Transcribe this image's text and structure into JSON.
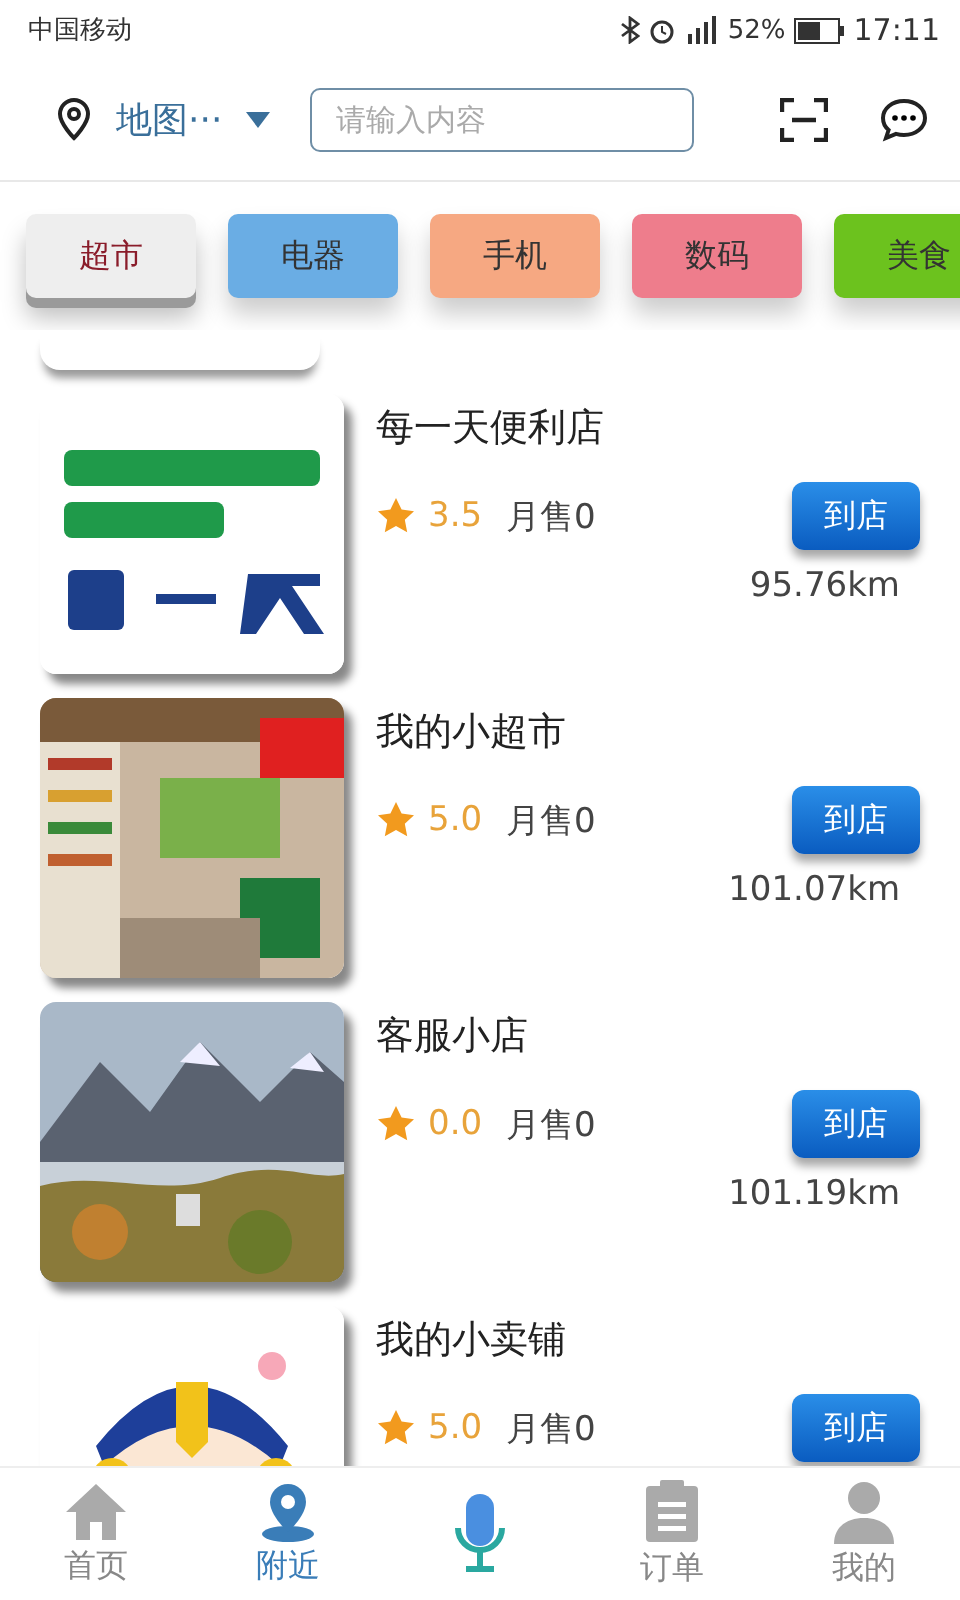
{
  "status_bar": {
    "carrier": "中国移动",
    "battery": "52%",
    "time": "17:11"
  },
  "header": {
    "location": "地图···",
    "search": {
      "placeholder": "请输入内容"
    }
  },
  "categories": [
    {
      "label": "超市",
      "color": "#eeeeee",
      "selected": true
    },
    {
      "label": "电器",
      "color": "#6aade4",
      "selected": false
    },
    {
      "label": "手机",
      "color": "#f6a882",
      "selected": false
    },
    {
      "label": "数码",
      "color": "#ee7d8c",
      "selected": false
    },
    {
      "label": "美食",
      "color": "#6cc21e",
      "selected": false
    }
  ],
  "stores": [
    {
      "name": "每一天便利店",
      "rating": "3.5",
      "sales": "月售0",
      "distance": "95.76km",
      "button": "到店"
    },
    {
      "name": "我的小超市",
      "rating": "5.0",
      "sales": "月售0",
      "distance": "101.07km",
      "button": "到店"
    },
    {
      "name": "客服小店",
      "rating": "0.0",
      "sales": "月售0",
      "distance": "101.19km",
      "button": "到店"
    },
    {
      "name": "我的小卖铺",
      "rating": "5.0",
      "sales": "月售0",
      "button": "到店"
    }
  ],
  "tabs": [
    {
      "label": "首页",
      "kind": "home",
      "selected": false
    },
    {
      "label": "附近",
      "kind": "nearby",
      "selected": true
    },
    {
      "kind": "mic",
      "selected": false
    },
    {
      "label": "订单",
      "kind": "orders",
      "selected": false
    },
    {
      "label": "我的",
      "kind": "profile",
      "selected": false
    }
  ]
}
